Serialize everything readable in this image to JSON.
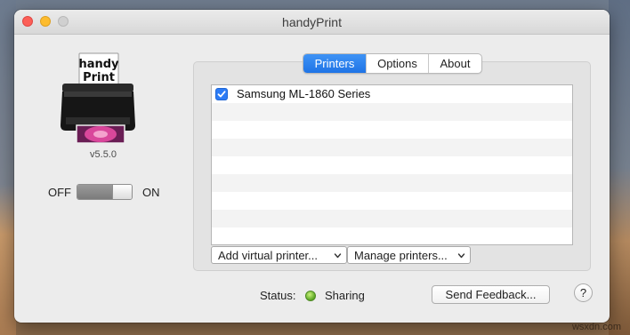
{
  "window": {
    "title": "handyPrint"
  },
  "app": {
    "logo_line1": "handy",
    "logo_line2": "Print",
    "version": "v5.5.0"
  },
  "sharing_toggle": {
    "off_label": "OFF",
    "on_label": "ON",
    "state": "off"
  },
  "tabs": [
    {
      "label": "Printers",
      "active": true
    },
    {
      "label": "Options",
      "active": false
    },
    {
      "label": "About",
      "active": false
    }
  ],
  "printers": {
    "rows": [
      {
        "name": "Samsung ML-1860 Series",
        "checked": true
      }
    ],
    "empty_row_count": 8
  },
  "popups": {
    "add_virtual": "Add virtual printer...",
    "manage": "Manage printers..."
  },
  "status": {
    "label": "Status:",
    "value": "Sharing",
    "color": "#5aa623"
  },
  "buttons": {
    "feedback": "Send Feedback...",
    "help": "?"
  },
  "watermark": "wsxdn.com",
  "colors": {
    "accent": "#1f74e6"
  },
  "icons": [
    "printer-logo-icon",
    "checkmark-icon",
    "chevron-updown-icon",
    "status-dot-icon"
  ]
}
